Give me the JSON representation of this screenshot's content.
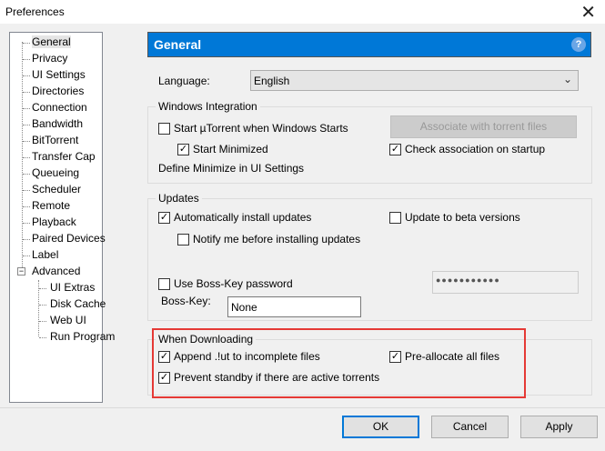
{
  "window": {
    "title": "Preferences"
  },
  "tree": {
    "items": [
      "General",
      "Privacy",
      "UI Settings",
      "Directories",
      "Connection",
      "Bandwidth",
      "BitTorrent",
      "Transfer Cap",
      "Queueing",
      "Scheduler",
      "Remote",
      "Playback",
      "Paired Devices",
      "Label",
      "Advanced"
    ],
    "advanced_children": [
      "UI Extras",
      "Disk Cache",
      "Web UI",
      "Run Program"
    ],
    "selected": "General"
  },
  "header": {
    "title": "General"
  },
  "language": {
    "label": "Language:",
    "value": "English"
  },
  "windows_integration": {
    "title": "Windows Integration",
    "start_with_windows": {
      "label": "Start µTorrent when Windows Starts",
      "checked": false
    },
    "start_minimized": {
      "label": "Start Minimized",
      "checked": true
    },
    "associate_button": "Associate with torrent files",
    "check_association": {
      "label": "Check association on startup",
      "checked": true
    },
    "define_minimize": "Define Minimize in UI Settings"
  },
  "updates": {
    "title": "Updates",
    "auto_install": {
      "label": "Automatically install updates",
      "checked": true
    },
    "beta": {
      "label": "Update to beta versions",
      "checked": false
    },
    "notify": {
      "label": "Notify me before installing updates",
      "checked": false
    },
    "boss_password": {
      "label": "Use Boss-Key password",
      "checked": false
    },
    "password_value": "●●●●●●●●●●●",
    "boss_key_label": "Boss-Key:",
    "boss_key_value": "None"
  },
  "when_downloading": {
    "title": "When Downloading",
    "append_ut": {
      "label": "Append .!ut to incomplete files",
      "checked": true
    },
    "preallocate": {
      "label": "Pre-allocate all files",
      "checked": true
    },
    "prevent_standby": {
      "label": "Prevent standby if there are active torrents",
      "checked": true
    }
  },
  "buttons": {
    "ok": "OK",
    "cancel": "Cancel",
    "apply": "Apply"
  }
}
